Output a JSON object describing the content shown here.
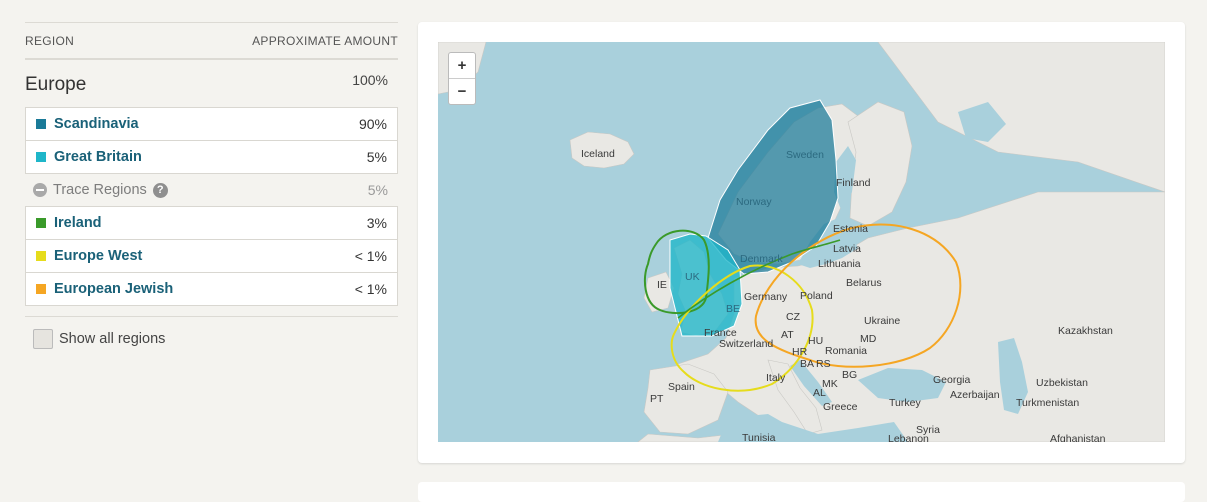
{
  "table": {
    "col_region": "REGION",
    "col_amount": "APPROXIMATE AMOUNT",
    "region": {
      "name": "Europe",
      "amount": "100%"
    },
    "rows": [
      {
        "name": "Scandinavia",
        "amount": "90%",
        "color": "#1a7a98"
      },
      {
        "name": "Great Britain",
        "amount": "5%",
        "color": "#1fb6c9"
      }
    ],
    "trace": {
      "label": "Trace Regions",
      "amount": "5%"
    },
    "trace_rows": [
      {
        "name": "Ireland",
        "amount": "3%",
        "color": "#3a9a2a"
      },
      {
        "name": "Europe West",
        "amount": "< 1%",
        "color": "#e6dc1c"
      },
      {
        "name": "European Jewish",
        "amount": "< 1%",
        "color": "#f5a623"
      }
    ],
    "show_all": "Show all regions"
  },
  "map": {
    "zoom_in": "+",
    "zoom_out": "−",
    "labels": {
      "iceland": "Iceland",
      "sweden": "Sweden",
      "finland": "Finland",
      "norway": "Norway",
      "estonia": "Estonia",
      "latvia": "Latvia",
      "lithuania": "Lithuania",
      "denmark": "Denmark",
      "belarus": "Belarus",
      "uk": "UK",
      "ie": "IE",
      "germany": "Germany",
      "poland": "Poland",
      "be": "BE",
      "cz": "CZ",
      "ukraine": "Ukraine",
      "kazakhstan": "Kazakhstan",
      "france": "France",
      "at": "AT",
      "hu": "HU",
      "md": "MD",
      "switzerland": "Switzerland",
      "hr": "HR",
      "romania": "Romania",
      "ba": "BA",
      "rs": "RS",
      "bg": "BG",
      "italy": "Italy",
      "mk": "MK",
      "georgia": "Georgia",
      "uzbekistan": "Uzbekistan",
      "spain": "Spain",
      "al": "AL",
      "azerbaijan": "Azerbaijan",
      "pt": "PT",
      "turkey": "Turkey",
      "turkmenistan": "Turkmenistan",
      "greece": "Greece",
      "syria": "Syria",
      "tunisia": "Tunisia",
      "lebanon": "Lebanon",
      "afghanistan": "Afghanistan"
    }
  }
}
